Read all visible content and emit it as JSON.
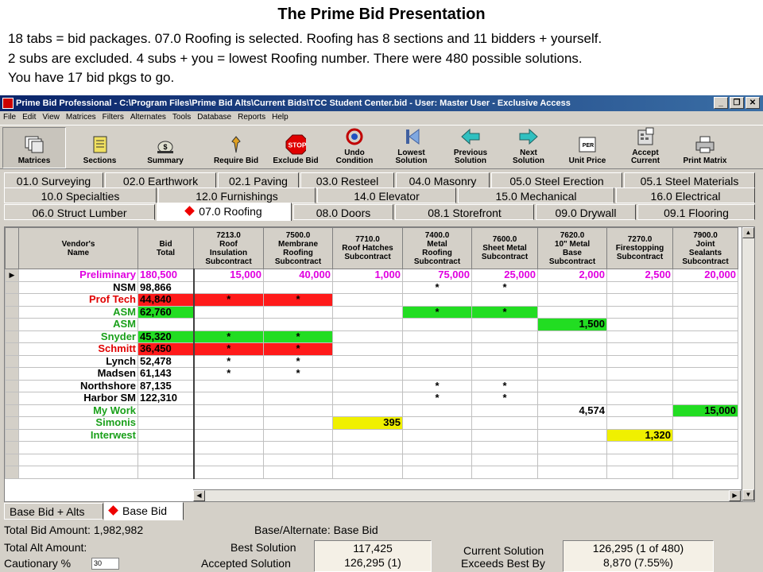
{
  "slide": {
    "title": "The Prime Bid Presentation",
    "lines": [
      "18 tabs = bid packages. 07.0 Roofing is selected. Roofing has 8 sections and 11 bidders + yourself.",
      "2 subs are excluded. 4 subs + you = lowest Roofing number. There were 480 possible solutions.",
      "You have 17 bid pkgs to go."
    ]
  },
  "window": {
    "title": "Prime Bid Professional - C:\\Program Files\\Prime Bid Alts\\Current Bids\\TCC Student Center.bid - User: Master User - Exclusive Access",
    "controls": [
      "_",
      "❐",
      "✕"
    ]
  },
  "menu": [
    "File",
    "Edit",
    "View",
    "Matrices",
    "Filters",
    "Alternates",
    "Tools",
    "Database",
    "Reports",
    "Help"
  ],
  "toolbar": {
    "matrices": "Matrices",
    "sections": "Sections",
    "summary": "Summary",
    "require_bid": "Require Bid",
    "exclude_bid": "Exclude Bid",
    "stop_text": "STOP",
    "undo": [
      "Undo",
      "Condition"
    ],
    "lowest": [
      "Lowest",
      "Solution"
    ],
    "previous": [
      "Previous",
      "Solution"
    ],
    "next": [
      "Next",
      "Solution"
    ],
    "unit_price": "Unit Price",
    "per_text": "PER",
    "accept": [
      "Accept",
      "Current"
    ],
    "print_matrix": "Print Matrix"
  },
  "tabs_row1": [
    "01.0 Surveying",
    "02.0 Earthwork",
    "02.1 Paving",
    "03.0 Resteel",
    "04.0 Masonry",
    "05.0 Steel Erection",
    "05.1 Steel Materials"
  ],
  "tabs_row2": [
    "10.0 Specialties",
    "12.0 Furnishings",
    "14.0 Elevator",
    "15.0 Mechanical",
    "16.0 Electrical"
  ],
  "tabs_row3": [
    "06.0 Struct Lumber",
    "07.0 Roofing",
    "08.0 Doors",
    "08.1 Storefront",
    "09.0 Drywall",
    "09.1 Flooring"
  ],
  "grid": {
    "header_vendor": [
      "Vendor's",
      "Name"
    ],
    "header_bid": [
      "Bid",
      "Total"
    ],
    "columns": [
      [
        "7213.0",
        "Roof",
        "Insulation",
        "Subcontract"
      ],
      [
        "7500.0",
        "Membrane",
        "Roofing",
        "Subcontract"
      ],
      [
        "7710.0",
        "Roof Hatches",
        "Subcontract"
      ],
      [
        "7400.0",
        "Metal",
        "Roofing",
        "Subcontract"
      ],
      [
        "7600.0",
        "Sheet Metal",
        "Subcontract"
      ],
      [
        "7620.0",
        "10\" Metal",
        "Base",
        "Subcontract"
      ],
      [
        "7270.0",
        "Firestopping",
        "Subcontract"
      ],
      [
        "7900.0",
        "Joint",
        "Sealants",
        "Subcontract"
      ]
    ],
    "rows": [
      {
        "vendor": "Preliminary",
        "total": "180,500",
        "cells": [
          "15,000",
          "40,000",
          "1,000",
          "75,000",
          "25,000",
          "2,000",
          "2,500",
          "20,000"
        ],
        "vendor_color": "#e000e0",
        "total_bg": "",
        "marker": "▶"
      },
      {
        "vendor": "NSM",
        "total": "98,866",
        "cells": [
          "",
          "",
          "",
          "*",
          "*",
          "",
          "",
          ""
        ],
        "vendor_color": "#000000",
        "total_bg": "",
        "marker": ""
      },
      {
        "vendor": "Prof Tech",
        "total": "44,840",
        "cells": [
          "*",
          "*",
          "",
          "",
          "",
          "",
          "",
          ""
        ],
        "vendor_color": "#e00000",
        "total_bg": "#ff1a1a",
        "marker": ""
      },
      {
        "vendor": "ASM",
        "total": "62,760",
        "cells": [
          "",
          "",
          "",
          "*",
          "*",
          "",
          "",
          ""
        ],
        "vendor_color": "#1aa01a",
        "total_bg": "#22dd22",
        "marker": ""
      },
      {
        "vendor": "ASM",
        "total": "",
        "cells": [
          "",
          "",
          "",
          "",
          "",
          "1,500",
          "",
          ""
        ],
        "vendor_color": "#1aa01a",
        "total_bg": "",
        "marker": ""
      },
      {
        "vendor": "Snyder",
        "total": "45,320",
        "cells": [
          "*",
          "*",
          "",
          "",
          "",
          "",
          "",
          ""
        ],
        "vendor_color": "#1aa01a",
        "total_bg": "#22dd22",
        "marker": ""
      },
      {
        "vendor": "Schmitt",
        "total": "36,450",
        "cells": [
          "*",
          "*",
          "",
          "",
          "",
          "",
          "",
          ""
        ],
        "vendor_color": "#e00000",
        "total_bg": "#ff1a1a",
        "marker": ""
      },
      {
        "vendor": "Lynch",
        "total": "52,478",
        "cells": [
          "*",
          "*",
          "",
          "",
          "",
          "",
          "",
          ""
        ],
        "vendor_color": "#000000",
        "total_bg": "",
        "marker": ""
      },
      {
        "vendor": "Madsen",
        "total": "61,143",
        "cells": [
          "*",
          "*",
          "",
          "",
          "",
          "",
          "",
          ""
        ],
        "vendor_color": "#000000",
        "total_bg": "",
        "marker": ""
      },
      {
        "vendor": "Northshore",
        "total": "87,135",
        "cells": [
          "",
          "",
          "",
          "*",
          "*",
          "",
          "",
          ""
        ],
        "vendor_color": "#000000",
        "total_bg": "",
        "marker": ""
      },
      {
        "vendor": "Harbor SM",
        "total": "122,310",
        "cells": [
          "",
          "",
          "",
          "*",
          "*",
          "",
          "",
          ""
        ],
        "vendor_color": "#000000",
        "total_bg": "",
        "marker": ""
      },
      {
        "vendor": "My Work",
        "total": "",
        "cells": [
          "",
          "",
          "",
          "",
          "",
          "4,574",
          "",
          "15,000"
        ],
        "vendor_color": "#1aa01a",
        "total_bg": "",
        "marker": ""
      },
      {
        "vendor": "Simonis",
        "total": "",
        "cells": [
          "",
          "",
          "395",
          "",
          "",
          "",
          "",
          ""
        ],
        "vendor_color": "#1aa01a",
        "total_bg": "",
        "marker": ""
      },
      {
        "vendor": "Interwest",
        "total": "",
        "cells": [
          "",
          "",
          "",
          "",
          "",
          "",
          "1,320",
          ""
        ],
        "vendor_color": "#1aa01a",
        "total_bg": "",
        "marker": ""
      }
    ],
    "cell_colors": {
      "2": [
        "#ff1a1a",
        "#ff1a1a",
        "",
        "",
        "",
        "",
        "",
        ""
      ],
      "3": [
        "",
        "",
        "",
        "#22dd22",
        "#22dd22",
        "",
        "",
        ""
      ],
      "4": [
        "",
        "",
        "",
        "",
        "",
        "#22dd22",
        "",
        ""
      ],
      "5": [
        "#22dd22",
        "#22dd22",
        "",
        "",
        "",
        "",
        "",
        ""
      ],
      "6": [
        "#ff1a1a",
        "#ff1a1a",
        "",
        "",
        "",
        "",
        "",
        ""
      ],
      "11": [
        "",
        "",
        "",
        "",
        "",
        "",
        "",
        "#22dd22"
      ],
      "12": [
        "",
        "",
        "#f0f000",
        "",
        "",
        "",
        "",
        ""
      ],
      "13": [
        "",
        "",
        "",
        "",
        "",
        "",
        "#f0f000",
        ""
      ]
    }
  },
  "bottom_tabs": [
    "Base Bid + Alts",
    "Base Bid"
  ],
  "summary": {
    "total_bid": "Total Bid Amount: 1,982,982",
    "base_alt": "Base/Alternate: Base Bid",
    "total_alt": "Total Alt Amount:",
    "cautionary_label": "Cautionary %",
    "cautionary_value": "30",
    "best_label": "Best Solution",
    "best_value": "117,425",
    "accepted_label": "Accepted Solution",
    "accepted_value": "126,295 (1)",
    "current_label": "Current Solution",
    "current_value": "126,295 (1 of 480)",
    "exceeds_label": "Exceeds Best By",
    "exceeds_value": "8,870 (7.55%)"
  }
}
